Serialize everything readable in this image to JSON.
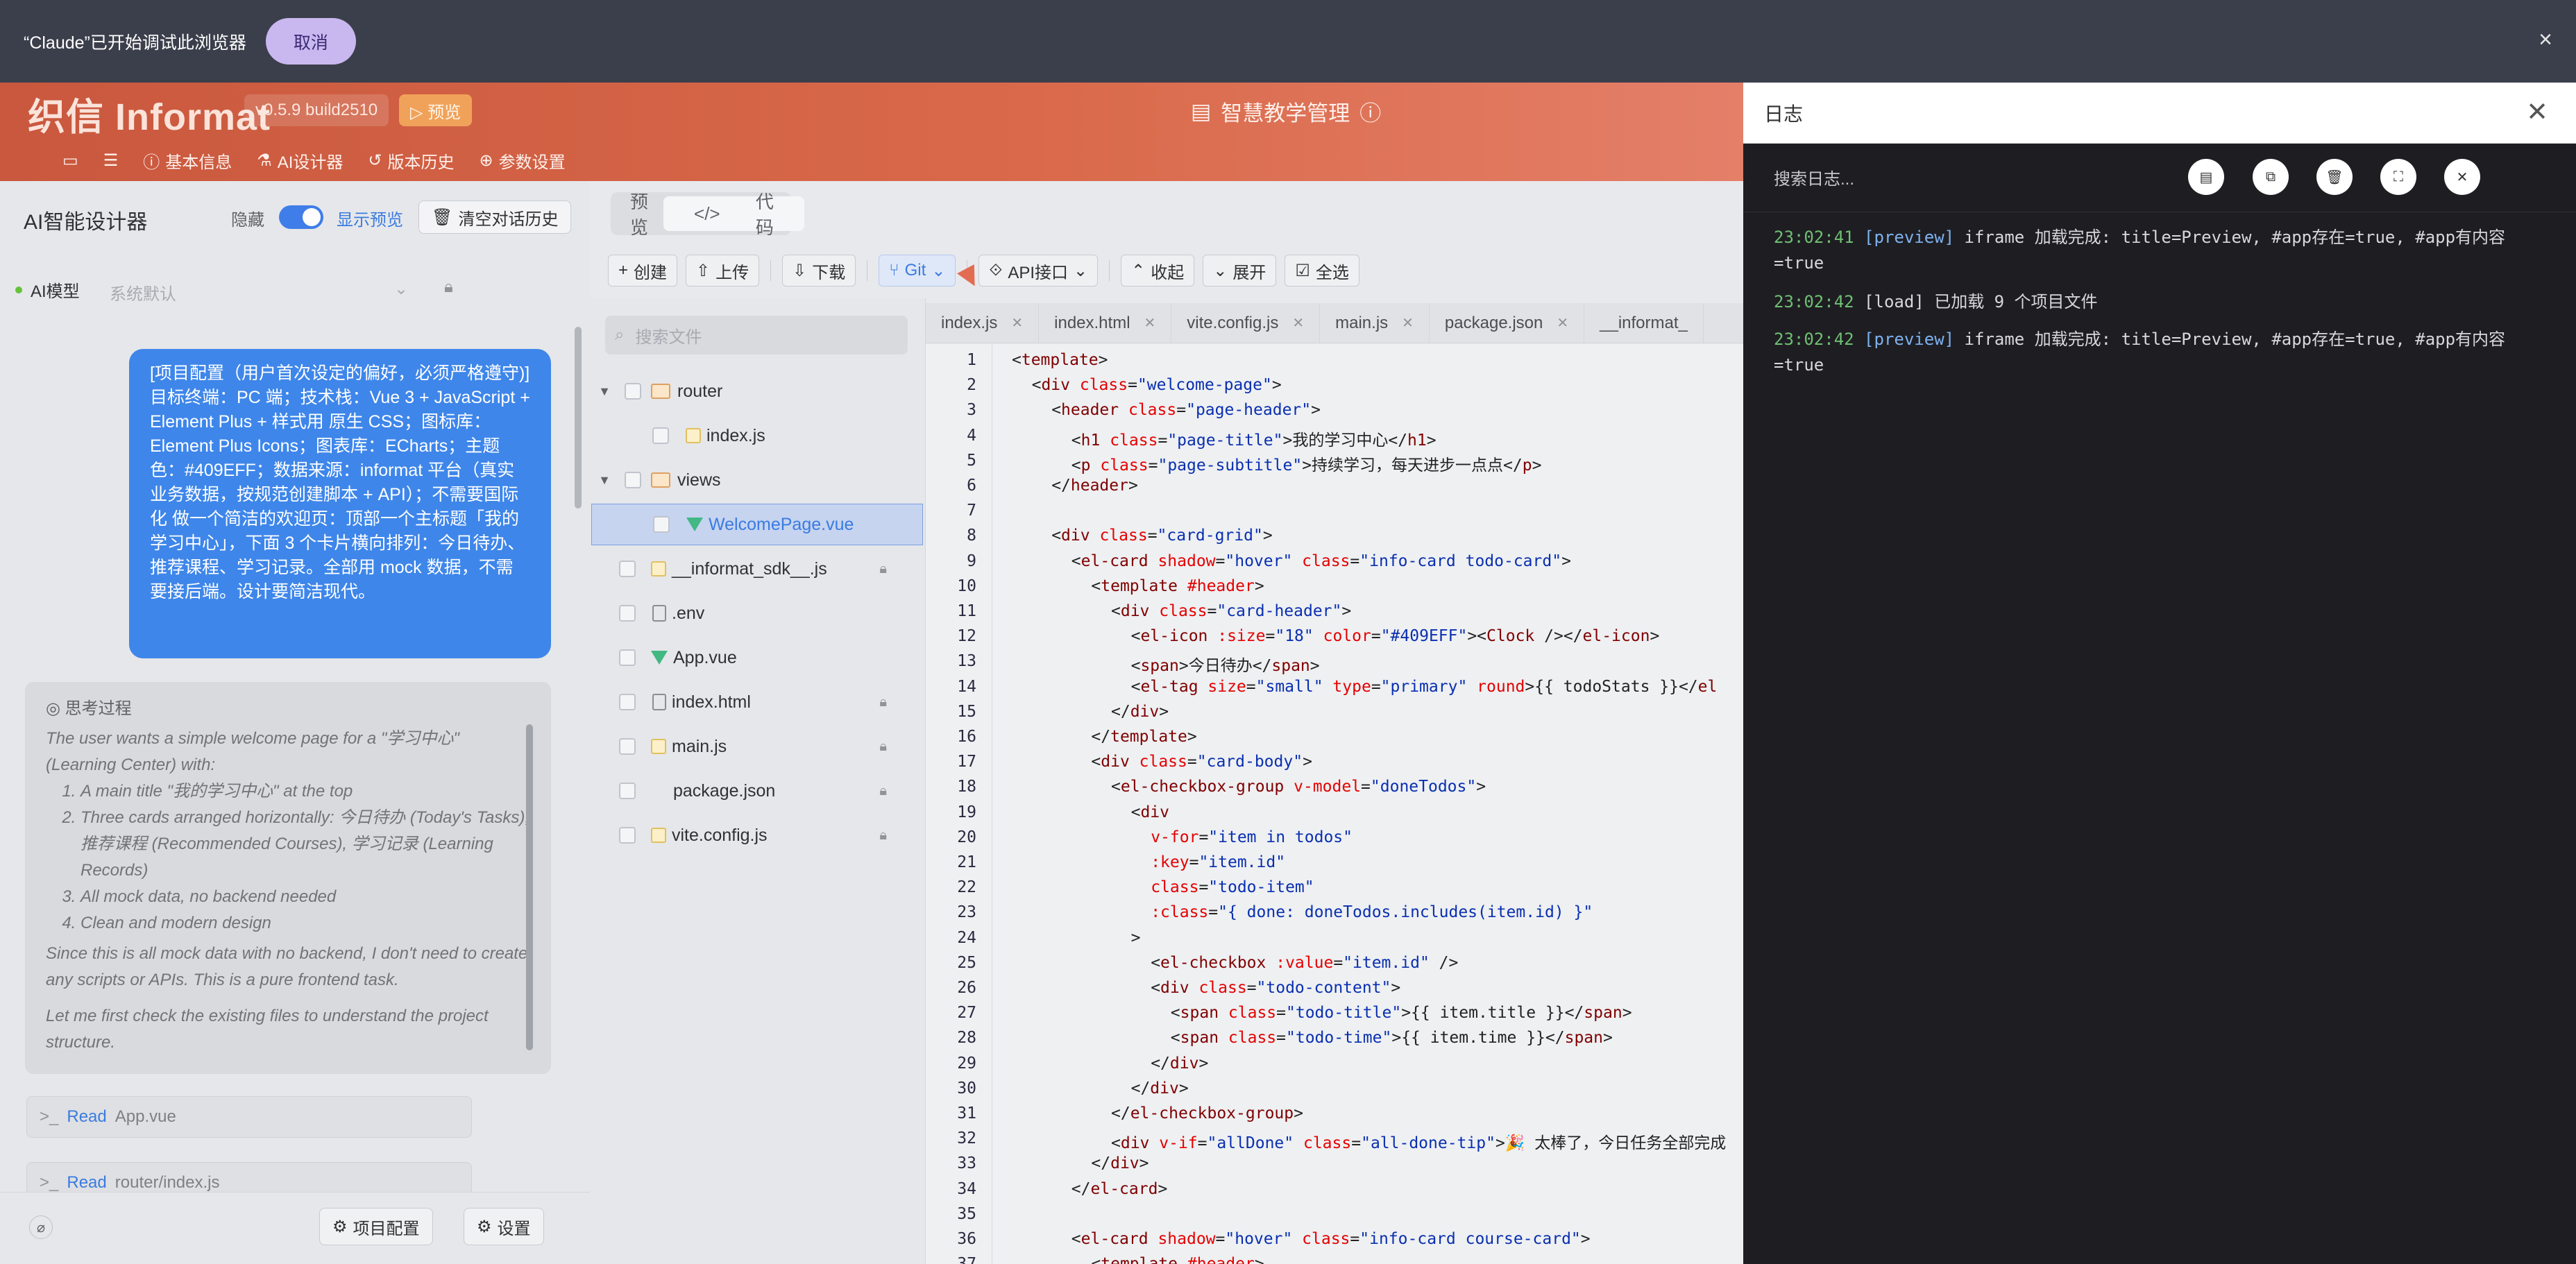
{
  "debug_bar": {
    "message": "“Claude”已开始调试此浏览器",
    "cancel": "取消",
    "close": "×"
  },
  "header": {
    "logo": "织信 Informat",
    "version": "v0.5.9 build2510",
    "preview": "▷ 预览",
    "app_title": "智慧教学管理",
    "nav": [
      "基本信息",
      "AI设计器",
      "版本历史",
      "参数设置"
    ]
  },
  "designer": {
    "title": "AI智能设计器",
    "hide": "隐藏",
    "show_preview": "显示预览",
    "clear": "清空对话历史",
    "model_label": "AI模型",
    "model_value": "系统默认",
    "user_message": "[项目配置（用户首次设定的偏好，必须严格遵守)] 目标终端：PC 端；技术栈：Vue 3 + JavaScript + Element Plus + 样式用 原生 CSS；图标库：Element Plus Icons；图表库：ECharts；主题色：#409EFF；数据来源：informat 平台（真实业务数据，按规范创建脚本 + API）；不需要国际化 做一个简洁的欢迎页：顶部一个主标题「我的学习中心」，下面 3 个卡片横向排列：今日待办、推荐课程、学习记录。全部用 mock 数据，不需要接后端。设计要简洁现代。",
    "thinking_header": "思考过程",
    "thinking_intro": "The user wants a simple welcome page for a \"学习中心\" (Learning Center) with:",
    "thinking_items": [
      "A main title \"我的学习中心\" at the top",
      "Three cards arranged horizontally: 今日待办 (Today's Tasks), 推荐课程 (Recommended Courses), 学习记录 (Learning Records)",
      "All mock data, no backend needed",
      "Clean and modern design"
    ],
    "thinking_p2": "Since this is all mock data with no backend, I don't need to create any scripts or APIs. This is a pure frontend task.",
    "thinking_p3": "Let me first check the existing files to understand the project structure.",
    "reads": [
      {
        "kw": "Read",
        "file": "App.vue"
      },
      {
        "kw": "Read",
        "file": "router/index.js"
      }
    ],
    "footer": {
      "project_config": "项目配置",
      "settings": "设置"
    }
  },
  "editor": {
    "view_tabs": [
      "预览",
      "代码"
    ],
    "toolbar": [
      "创建",
      "上传",
      "下载",
      "Git",
      "API接口",
      "收起",
      "展开",
      "全选"
    ],
    "search_placeholder": "搜索文件",
    "tree": [
      {
        "name": "router",
        "type": "folder",
        "open": true
      },
      {
        "name": "index.js",
        "type": "js"
      },
      {
        "name": "views",
        "type": "folder",
        "open": true
      },
      {
        "name": "WelcomePage.vue",
        "type": "vue",
        "selected": true
      },
      {
        "name": "__informat_sdk__.js",
        "type": "js",
        "locked": true
      },
      {
        "name": ".env",
        "type": "doc"
      },
      {
        "name": "App.vue",
        "type": "vue"
      },
      {
        "name": "index.html",
        "type": "doc",
        "locked": true
      },
      {
        "name": "main.js",
        "type": "js",
        "locked": true
      },
      {
        "name": "package.json",
        "type": "none",
        "locked": true
      },
      {
        "name": "vite.config.js",
        "type": "js",
        "locked": true
      }
    ],
    "tabs": [
      "index.js",
      "index.html",
      "vite.config.js",
      "main.js",
      "package.json",
      "__informat_"
    ],
    "line_numbers": [
      "1",
      "2",
      "3",
      "4",
      "5",
      "6",
      "7",
      "8",
      "9",
      "10",
      "11",
      "12",
      "13",
      "14",
      "15",
      "16",
      "17",
      "18",
      "19",
      "20",
      "21",
      "22",
      "23",
      "24",
      "25",
      "26",
      "27",
      "28",
      "29",
      "30",
      "31",
      "32",
      "33",
      "34",
      "35",
      "36",
      "37"
    ]
  },
  "log": {
    "title": "日志",
    "search_placeholder": "搜索日志...",
    "entries": [
      {
        "time": "23:02:41",
        "tag": "[preview]",
        "text": " iframe 加载完成: title=Preview, #app存在=true, #app有内容=true"
      },
      {
        "time": "23:02:42",
        "tag": "[load]",
        "text": " 已加载 9 个项目文件"
      },
      {
        "time": "23:02:42",
        "tag": "[preview]",
        "text": " iframe 加载完成: title=Preview, #app存在=true, #app有内容=true"
      }
    ]
  },
  "colors": {
    "accent": "#409EFF",
    "brand": "#D9694A",
    "log_bg": "#1E1E22"
  }
}
